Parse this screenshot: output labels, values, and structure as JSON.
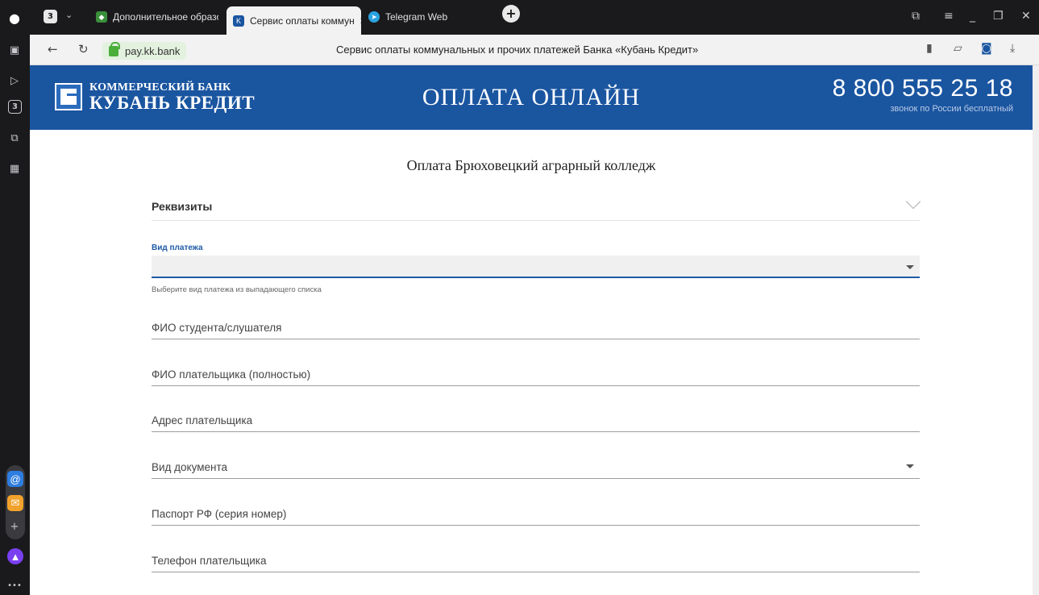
{
  "browser": {
    "tabs_count_badge": "3",
    "tabs": [
      {
        "title": "Дополнительное образов",
        "favicon_color": "#3a8f3a"
      },
      {
        "title": "Сервис оплаты коммун",
        "favicon_color": "#1a55a0",
        "close": "✕"
      },
      {
        "title": "Telegram Web",
        "favicon_color": "#2aa3e0"
      }
    ],
    "new_tab_icon": "+",
    "url": "pay.kk.bank",
    "page_heading": "Сервис оплаты коммунальных и прочих платежей Банка «Кубань Кредит»",
    "sidebar_badge": "3"
  },
  "header": {
    "logo_line1": "КОММЕРЧЕСКИЙ БАНК",
    "logo_line2": "КУБАНЬ КРЕДИТ",
    "title": "ОПЛАТА ОНЛАЙН",
    "phone": "8 800 555 25 18",
    "phone_note": "звонок по России бесплатный",
    "bg_color": "#1a55a0"
  },
  "form": {
    "title": "Оплата Брюховецкий аграрный колледж",
    "section_label": "Реквизиты",
    "payment_type": {
      "label": "Вид платежа",
      "value": "",
      "hint": "Выберите вид платежа из выпадающего списка"
    },
    "fields": [
      {
        "label": "ФИО студента/слушателя"
      },
      {
        "label": "ФИО плательщика (полностью)"
      },
      {
        "label": "Адрес плательщика"
      },
      {
        "label": "Вид документа",
        "dropdown": true
      },
      {
        "label": "Паспорт РФ (серия номер)"
      },
      {
        "label": "Телефон плательщика"
      }
    ]
  }
}
